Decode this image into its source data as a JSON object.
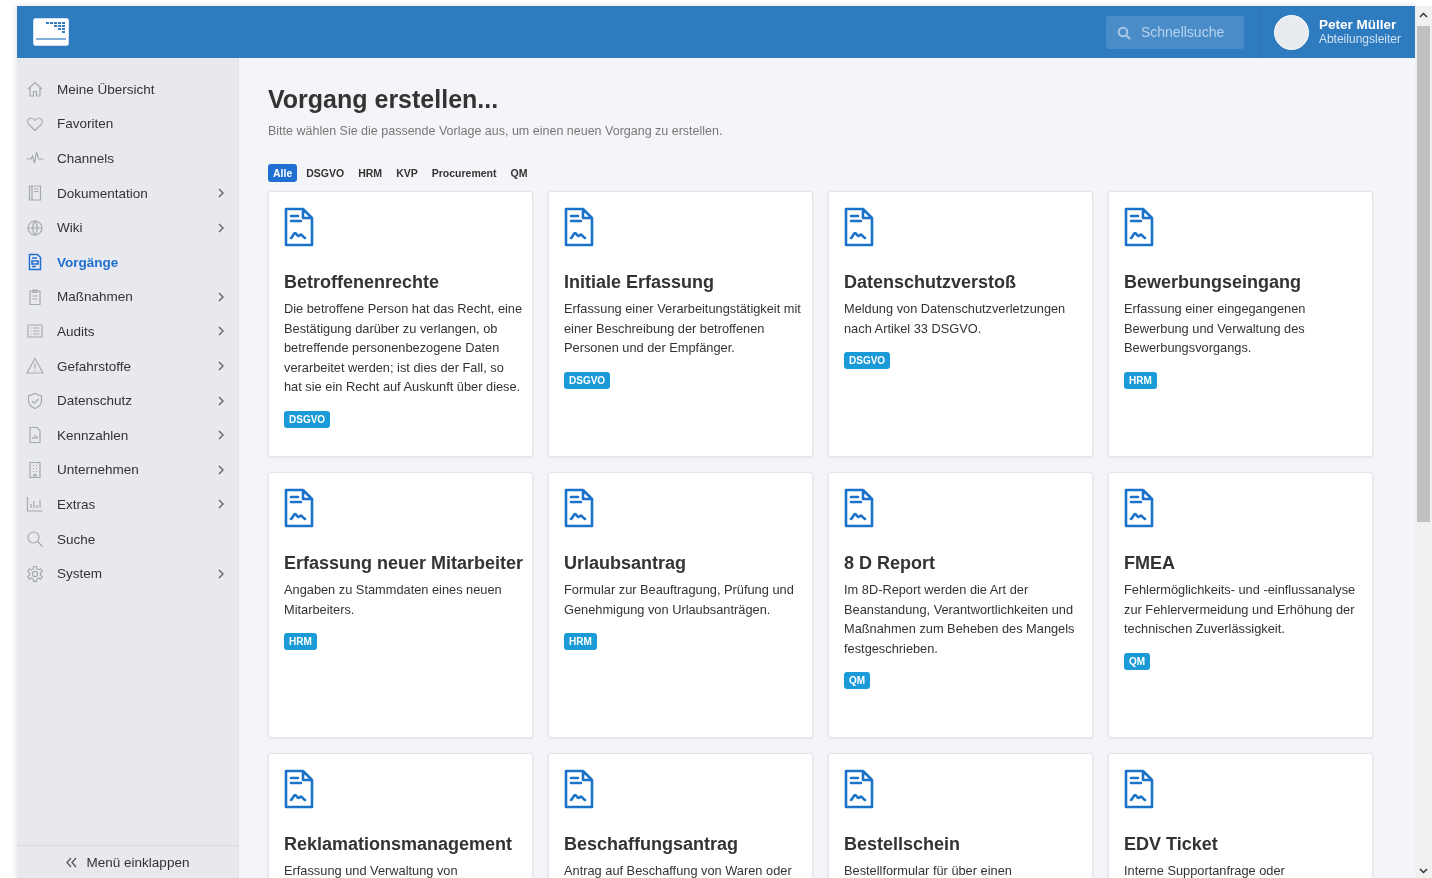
{
  "header": {
    "search": {
      "placeholder": "Schnellsuche"
    },
    "user": {
      "name": "Peter Müller",
      "role": "Abteilungsleiter"
    }
  },
  "sidebar": {
    "items": [
      {
        "label": "Meine Übersicht",
        "selected": false,
        "submenu": false
      },
      {
        "label": "Favoriten",
        "selected": false,
        "submenu": false
      },
      {
        "label": "Channels",
        "selected": false,
        "submenu": false
      },
      {
        "label": "Dokumentation",
        "selected": false,
        "submenu": true
      },
      {
        "label": "Wiki",
        "selected": false,
        "submenu": true
      },
      {
        "label": "Vorgänge",
        "selected": true,
        "submenu": false
      },
      {
        "label": "Maßnahmen",
        "selected": false,
        "submenu": true
      },
      {
        "label": "Audits",
        "selected": false,
        "submenu": true
      },
      {
        "label": "Gefahrstoffe",
        "selected": false,
        "submenu": true
      },
      {
        "label": "Datenschutz",
        "selected": false,
        "submenu": true
      },
      {
        "label": "Kennzahlen",
        "selected": false,
        "submenu": true
      },
      {
        "label": "Unternehmen",
        "selected": false,
        "submenu": true
      },
      {
        "label": "Extras",
        "selected": false,
        "submenu": true
      },
      {
        "label": "Suche",
        "selected": false,
        "submenu": false
      },
      {
        "label": "System",
        "selected": false,
        "submenu": true
      }
    ],
    "collapse": "Menü einklappen"
  },
  "page": {
    "title": "Vorgang erstellen...",
    "subtitle": "Bitte wählen Sie die passende Vorlage aus, um einen neuen Vorgang zu erstellen."
  },
  "filters": [
    {
      "label": "Alle",
      "selected": true
    },
    {
      "label": "DSGVO",
      "selected": false
    },
    {
      "label": "HRM",
      "selected": false
    },
    {
      "label": "KVP",
      "selected": false
    },
    {
      "label": "Procurement",
      "selected": false
    },
    {
      "label": "QM",
      "selected": false
    }
  ],
  "cards": [
    {
      "title": "Betroffenenrechte",
      "description": "Die betroffene Person hat das Recht, eine Bestätigung darüber zu verlangen, ob betreffende personenbezogene Daten verarbeitet werden; ist dies der Fall, so hat sie ein Recht auf Auskunft über diese.",
      "tag": "DSGVO"
    },
    {
      "title": "Initiale Erfassung",
      "description": "Erfassung einer Verarbeitungstätigkeit mit einer Beschreibung der betroffenen Personen und der Empfänger.",
      "tag": "DSGVO"
    },
    {
      "title": "Datenschutzverstoß",
      "description": "Meldung von Datenschutzverletzungen nach Artikel 33 DSGVO.",
      "tag": "DSGVO"
    },
    {
      "title": "Bewerbungseingang",
      "description": "Erfassung einer eingegangenen Bewerbung und Verwaltung des Bewerbungsvorgangs.",
      "tag": "HRM"
    },
    {
      "title": "Erfassung neuer Mitarbeiter",
      "description": "Angaben zu Stammdaten eines neuen Mitarbeiters.",
      "tag": "HRM"
    },
    {
      "title": "Urlaubsantrag",
      "description": "Formular zur Beauftragung, Prüfung und Genehmigung von Urlaubsanträgen.",
      "tag": "HRM"
    },
    {
      "title": "8 D Report",
      "description": "Im 8D-Report werden die Art der Beanstandung, Verantwortlichkeiten und Maßnahmen zum Beheben des Mangels festgeschrieben.",
      "tag": "QM"
    },
    {
      "title": "FMEA",
      "description": "Fehlermöglichkeits- und -einflussanalyse zur Fehlervermeidung und Erhöhung der technischen Zuverlässigkeit.",
      "tag": "QM"
    },
    {
      "title": "Reklamationsmanagement",
      "description": "Erfassung und Verwaltung von"
    },
    {
      "title": "Beschaffungsantrag",
      "description": "Antrag auf Beschaffung von Waren oder"
    },
    {
      "title": "Bestellschein",
      "description": "Bestellformular für über einen"
    },
    {
      "title": "EDV Ticket",
      "description": "Interne Supportanfrage oder"
    }
  ]
}
